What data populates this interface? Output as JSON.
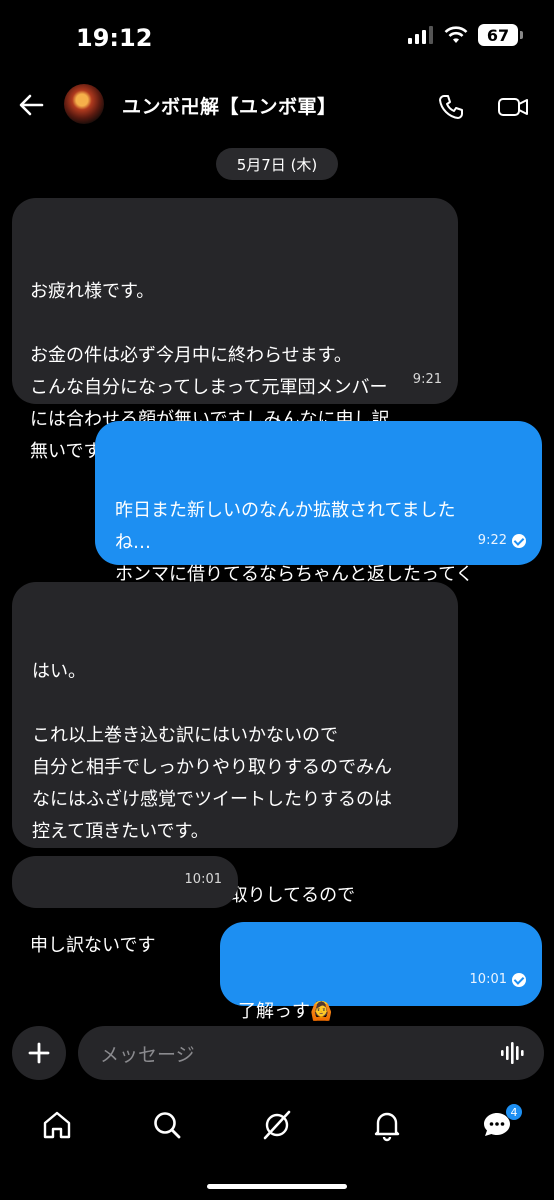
{
  "status": {
    "time": "19:12",
    "battery": "67"
  },
  "header": {
    "name": "ユンボ卍解【ユンボ軍】"
  },
  "date_divider": "5月7日 (木)",
  "messages": [
    {
      "dir": "in",
      "text": "お疲れ様です。\n\nお金の件は必ず今月中に終わらせます。\nこんな自分になってしまって元軍団メンバー\nには合わせる顔が無いですしみんなに申し訳\n無いです",
      "time": "9:21"
    },
    {
      "dir": "out",
      "text": "昨日また新しいのなんか拡散されてました\nね…\nホンマに借りてるならちゃんと返したってく\nださいな👍´-",
      "time": "9:22"
    },
    {
      "dir": "in",
      "text": "はい。\n\nこれ以上巻き込む訳にはいかないので\n自分と相手でしっかりやり取りするのでみん\nなにはふざけ感覚でツイートしたりするのは\n控えて頂きたいです。\n\nすでにもう個人間でやり取りしてるので",
      "time": ""
    },
    {
      "dir": "in",
      "text": "申し訳ないです",
      "time": "10:01"
    },
    {
      "dir": "out",
      "text": "了解っす🙆\n言うときます (*`･ω･)ゞ",
      "time": "10:01"
    }
  ],
  "composer": {
    "placeholder": "メッセージ"
  },
  "tabbar": {
    "badge": "4"
  },
  "colors": {
    "outgoing": "#1d8ff2",
    "incoming": "#262629"
  }
}
